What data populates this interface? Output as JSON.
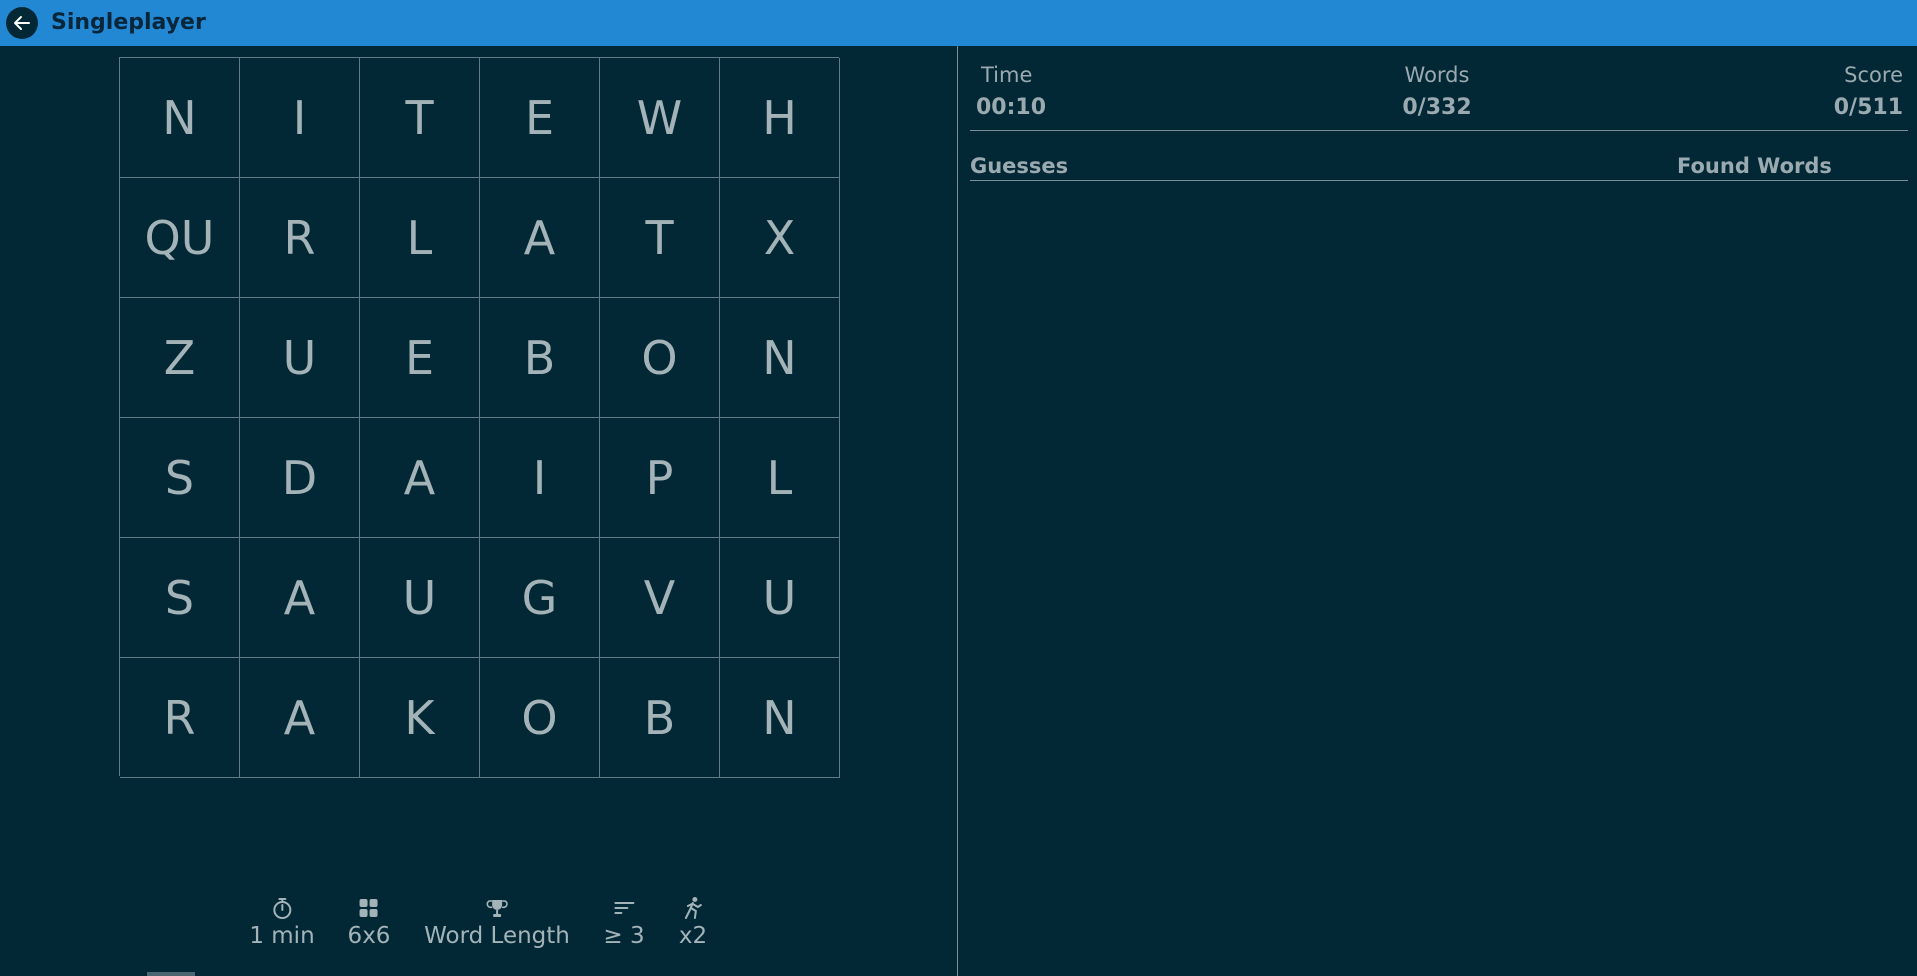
{
  "header": {
    "title": "Singleplayer",
    "back_icon": "arrow-left-icon"
  },
  "board": {
    "rows": [
      [
        "N",
        "I",
        "T",
        "E",
        "W",
        "H"
      ],
      [
        "QU",
        "R",
        "L",
        "A",
        "T",
        "X"
      ],
      [
        "Z",
        "U",
        "E",
        "B",
        "O",
        "N"
      ],
      [
        "S",
        "D",
        "A",
        "I",
        "P",
        "L"
      ],
      [
        "S",
        "A",
        "U",
        "G",
        "V",
        "U"
      ],
      [
        "R",
        "A",
        "K",
        "O",
        "B",
        "N"
      ]
    ]
  },
  "settings": [
    {
      "icon": "stopwatch-icon",
      "label": "1 min"
    },
    {
      "icon": "grid-icon",
      "label": "6x6"
    },
    {
      "icon": "trophy-icon",
      "label": "Word Length"
    },
    {
      "icon": "sort-lines-icon",
      "label": "≥ 3"
    },
    {
      "icon": "runner-icon",
      "label": "x2"
    }
  ],
  "stats": {
    "time": {
      "label": "Time",
      "value": "00:10"
    },
    "words": {
      "label": "Words",
      "value": "0/332"
    },
    "score": {
      "label": "Score",
      "value": "0/511"
    }
  },
  "lists": {
    "guesses_label": "Guesses",
    "found_words_label": "Found Words",
    "guesses": [],
    "found_words": []
  },
  "colors": {
    "background": "#022836",
    "header": "#2288d4",
    "letters": "#a3b3b8",
    "grid_lines": "#5f7c86"
  }
}
